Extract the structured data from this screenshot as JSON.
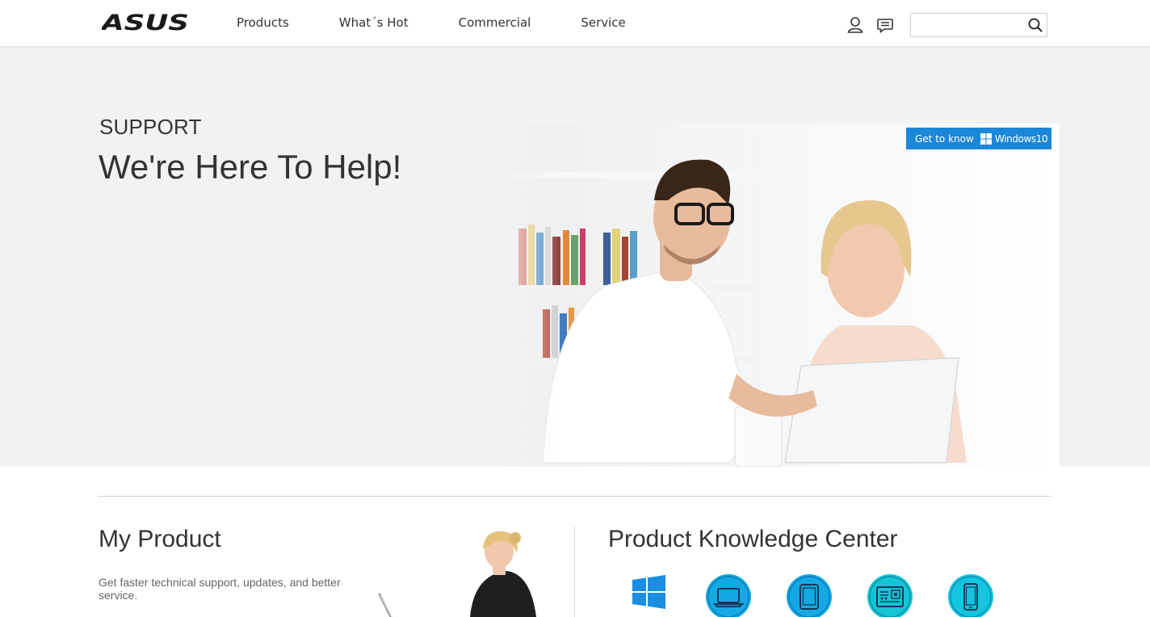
{
  "header": {
    "brand": "ASUS",
    "nav": [
      "Products",
      "What´s Hot",
      "Commercial",
      "Service"
    ],
    "search_placeholder": "",
    "icons": [
      "user-icon",
      "chat-icon",
      "search-icon"
    ]
  },
  "hero": {
    "label": "SUPPORT",
    "title": "We're Here To Help!",
    "badge": {
      "text": "Get to know",
      "product": "Windows10"
    }
  },
  "my_product": {
    "title": "My Product",
    "description": "Get faster technical support, updates, and better service."
  },
  "knowledge": {
    "title": "Product Knowledge Center",
    "icons": [
      "windows-icon",
      "laptop-icon",
      "tablet-icon",
      "motherboard-icon",
      "phone-icon"
    ]
  },
  "colors": {
    "accent": "#1b87d8",
    "icon_circle": "#14a9e4",
    "hero_bg": "#f1f2f4"
  }
}
